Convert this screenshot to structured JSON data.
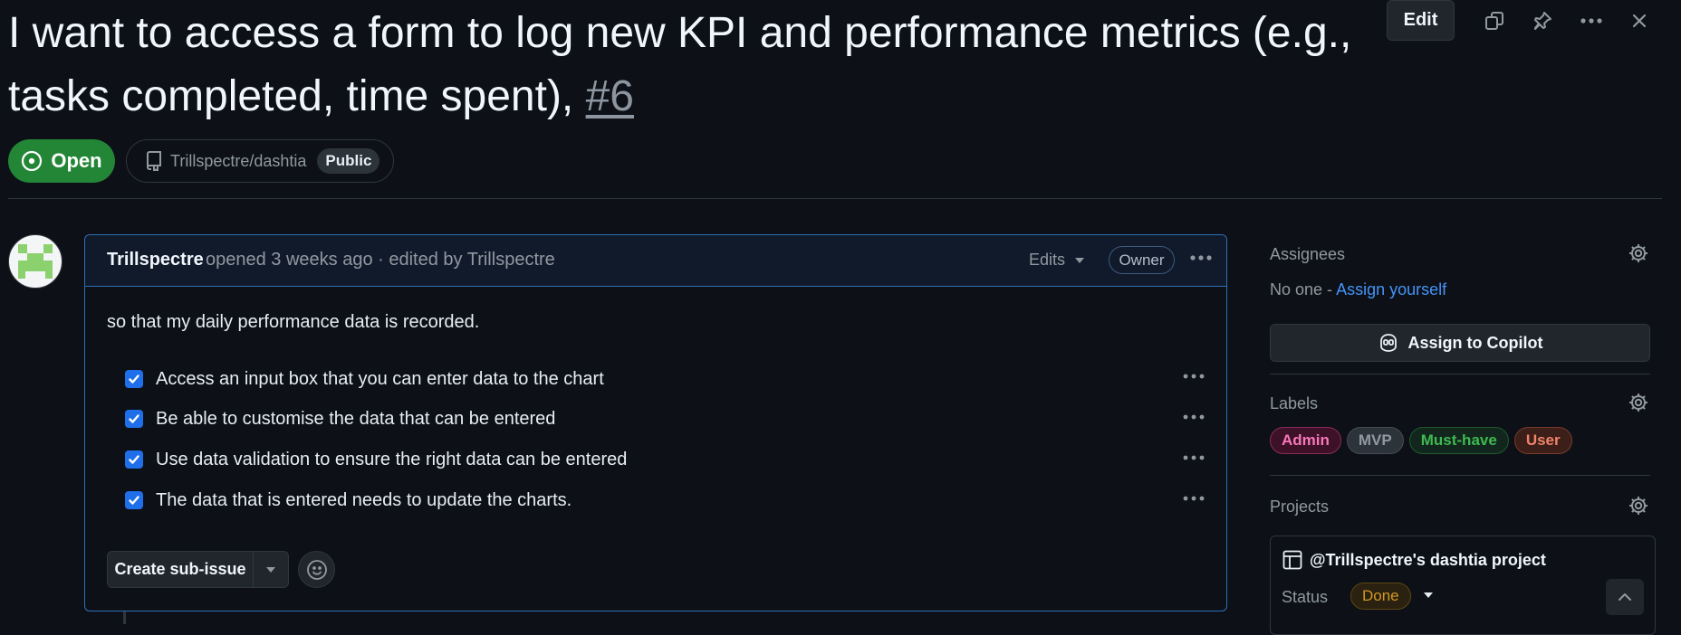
{
  "issue": {
    "title": "I want to access a form to log new KPI and performance metrics (e.g., tasks completed, time spent),",
    "number": "#6",
    "state": "Open",
    "repo": "Trillspectre/dashtia",
    "visibility": "Public"
  },
  "toolbar": {
    "edit_label": "Edit",
    "icons": [
      "copy-icon",
      "pin-icon",
      "more-icon",
      "close-icon"
    ]
  },
  "comment": {
    "author": "Trillspectre",
    "meta": "opened 3 weeks ago · edited by Trillspectre",
    "edits_label": "Edits",
    "role_badge": "Owner",
    "body": "so that my daily performance data is recorded.",
    "tasks": [
      {
        "text": "Access an input box that you can enter data to the chart",
        "checked": true
      },
      {
        "text": "Be able to customise the data that can be entered",
        "checked": true
      },
      {
        "text": "Use data validation to ensure the right data can be entered",
        "checked": true
      },
      {
        "text": "The data that is entered needs to update the charts.",
        "checked": true
      }
    ],
    "create_subissue_label": "Create sub-issue"
  },
  "sidebar": {
    "assignees": {
      "heading": "Assignees",
      "none_text": "No one -",
      "assign_link": "Assign yourself",
      "copilot_button": "Assign to Copilot"
    },
    "labels": {
      "heading": "Labels",
      "items": [
        {
          "name": "Admin",
          "color": "#f778ba",
          "bg": "#3d1127",
          "border": "#8b2b5c"
        },
        {
          "name": "MVP",
          "color": "#9198a1",
          "bg": "#2d333b",
          "border": "#444c56"
        },
        {
          "name": "Must-have",
          "color": "#3fb950",
          "bg": "#12261e",
          "border": "#1f5b2d"
        },
        {
          "name": "User",
          "color": "#f0836b",
          "bg": "#3b1f18",
          "border": "#7a3a2b"
        }
      ]
    },
    "projects": {
      "heading": "Projects",
      "project_name": "@Trillspectre's dashtia project",
      "status_label": "Status",
      "status_value": "Done"
    }
  },
  "colors": {
    "open_green": "#238636",
    "accent_blue": "#1f6feb",
    "link_blue": "#4493f8",
    "background": "#0d1117"
  }
}
